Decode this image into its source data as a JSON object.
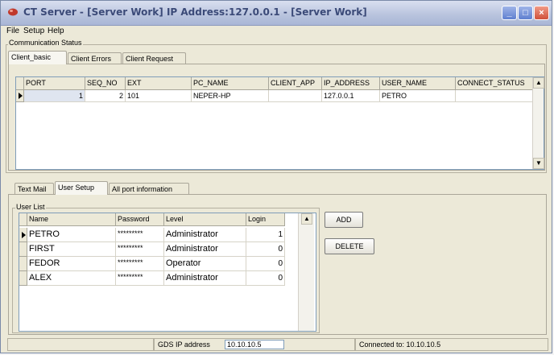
{
  "window": {
    "title": "CT Server - [Server Work] IP Address:127.0.0.1 - [Server Work]",
    "controls": {
      "minimize": "_",
      "maximize": "□",
      "close": "×"
    }
  },
  "menu": [
    "File",
    "Setup",
    "Help"
  ],
  "comm": {
    "label": "Communication Status",
    "tabs": [
      "Client_basic",
      "Client Errors",
      "Client Request"
    ],
    "columns": [
      "PORT",
      "SEQ_NO",
      "EXT",
      "PC_NAME",
      "CLIENT_APP",
      "IP_ADDRESS",
      "USER_NAME",
      "CONNECT_STATUS"
    ],
    "rows": [
      [
        "1",
        "2",
        "101",
        "NEPER-HP",
        "",
        "127.0.0.1",
        "PETRO",
        ""
      ]
    ]
  },
  "lower_tabs": [
    "Text Mail",
    "User Setup",
    "All port information"
  ],
  "users": {
    "label": "User List",
    "columns": [
      "Name",
      "Password",
      "Level",
      "Login"
    ],
    "rows": [
      [
        "PETRO",
        "*********",
        "Administrator",
        "1"
      ],
      [
        "FIRST",
        "*********",
        "Administrator",
        "0"
      ],
      [
        "FEDOR",
        "*********",
        "Operator",
        "0"
      ],
      [
        "ALEX",
        "*********",
        "Administrator",
        "0"
      ]
    ],
    "add_label": "ADD",
    "delete_label": "DELETE"
  },
  "status": {
    "gds_label": "GDS IP address",
    "gds_value": "10.10.10.5",
    "connected_text": "Connected to: 10.10.10.5"
  }
}
